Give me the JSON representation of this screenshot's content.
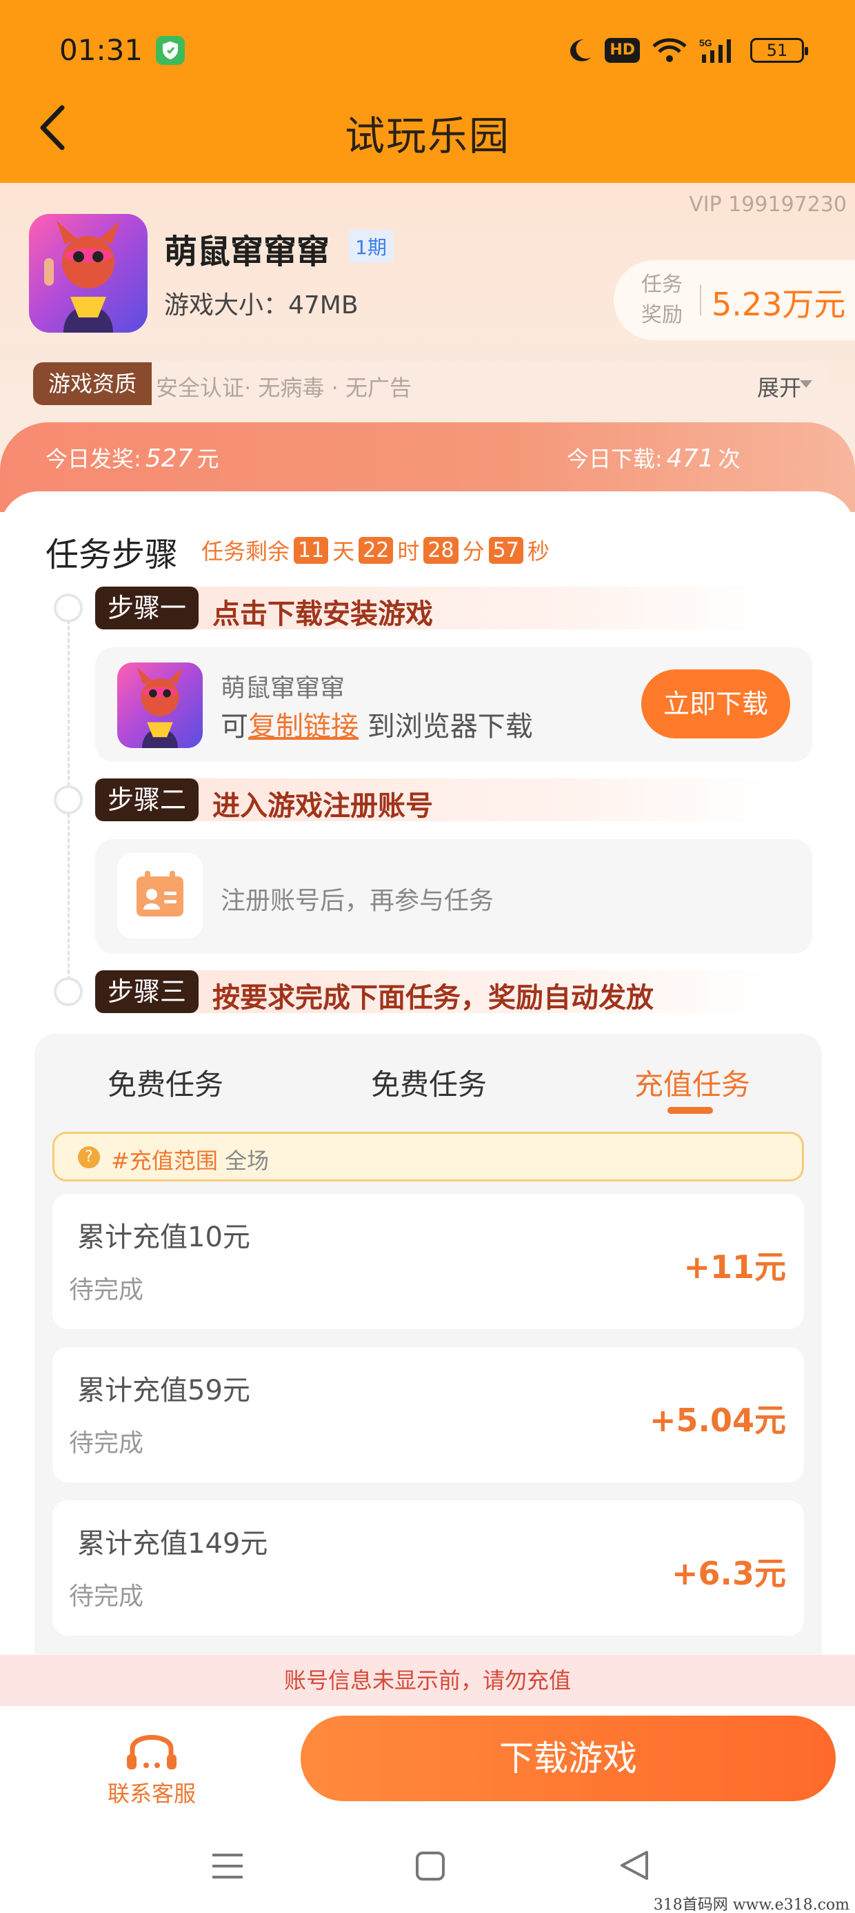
{
  "status_bar": {
    "time": "01:31",
    "battery": "51",
    "hd": "HD",
    "network": "5G"
  },
  "header": {
    "title": "试玩乐园"
  },
  "game": {
    "vip_id": "VIP 199197230",
    "name": "萌鼠窜窜窜",
    "period": "1期",
    "size_text": "游戏大小：47MB",
    "reward_label": "任务奖励",
    "reward_value": "5.23万元",
    "qualification_tag": "游戏资质",
    "qualification_text": "安全认证· 无病毒 · 无广告",
    "expand_label": "展开"
  },
  "stats": {
    "today_award_label": "今日发奖:",
    "today_award_value": "527",
    "today_award_unit": "元",
    "today_download_label": "今日下载:",
    "today_download_value": "471",
    "today_download_unit": "次"
  },
  "steps": {
    "title": "任务步骤",
    "countdown": {
      "prefix": "任务剩余",
      "days": "11",
      "day_unit": "天",
      "hours": "22",
      "hour_unit": "时",
      "minutes": "28",
      "minute_unit": "分",
      "seconds": "57",
      "second_unit": "秒"
    },
    "step1": {
      "tag": "步骤一",
      "text": "点击下载安装游戏",
      "game_name": "萌鼠窜窜窜",
      "line_prefix": "可",
      "copy_link": "复制链接",
      "line_suffix": " 到浏览器下载",
      "download_button": "立即下载"
    },
    "step2": {
      "tag": "步骤二",
      "text": "进入游戏注册账号",
      "hint": "注册账号后，再参与任务"
    },
    "step3": {
      "tag": "步骤三",
      "text": "按要求完成下面任务，奖励自动发放"
    }
  },
  "tasks": {
    "tabs": [
      "免费任务",
      "免费任务",
      "充值任务"
    ],
    "active_tab": 2,
    "scope_label": "#充值范围",
    "scope_value": " 全场",
    "items": [
      {
        "name": "累计充值10元",
        "status": "待完成",
        "reward": "+11元"
      },
      {
        "name": "累计充值59元",
        "status": "待完成",
        "reward": "+5.04元"
      },
      {
        "name": "累计充值149元",
        "status": "待完成",
        "reward": "+6.3元"
      }
    ]
  },
  "warning": "账号信息未显示前，请勿充值",
  "bottom": {
    "support_label": "联系客服",
    "download_button": "下载游戏"
  },
  "watermark": "318首码网 www.e318.com",
  "colors": {
    "primary_orange": "#FD9A12",
    "accent": "#f0762f",
    "step_tag_bg": "#3a1f14"
  }
}
